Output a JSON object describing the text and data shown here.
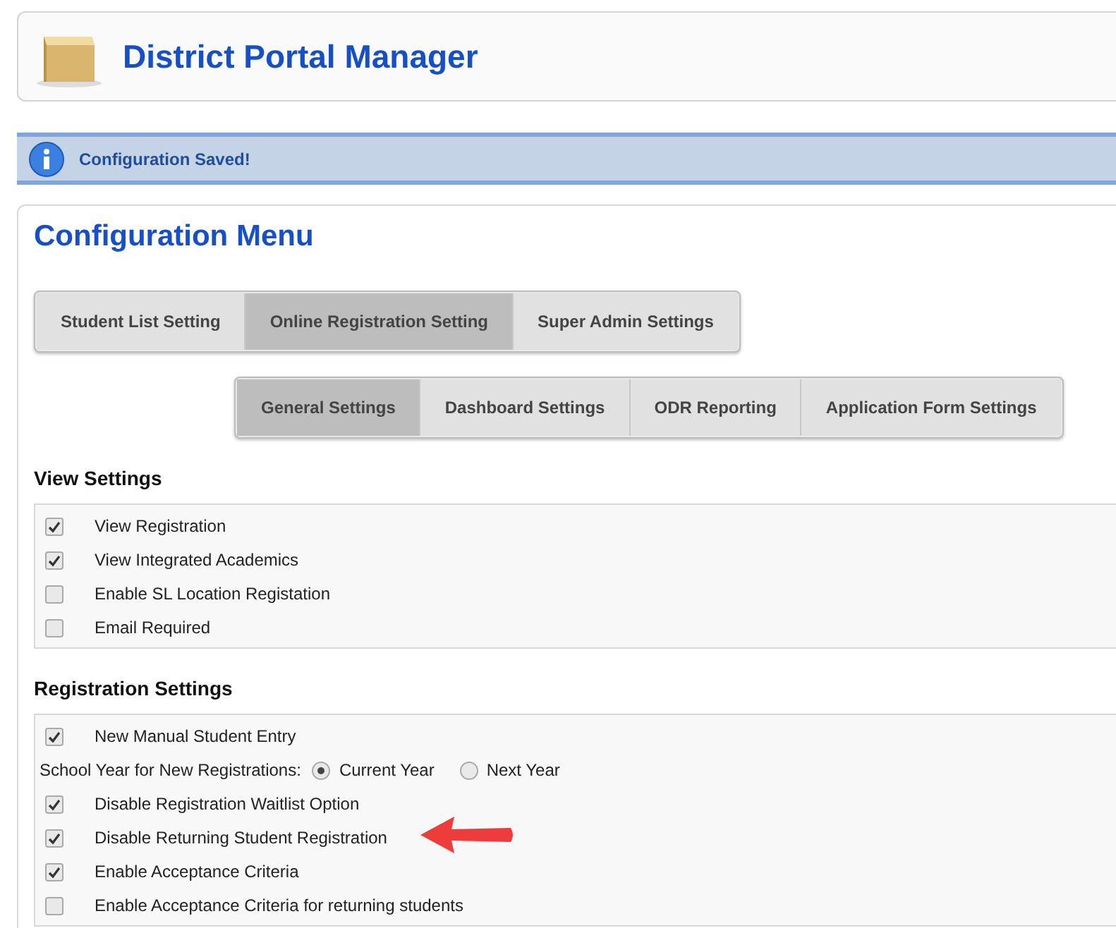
{
  "header": {
    "title": "District Portal Manager"
  },
  "notice": {
    "message": "Configuration Saved!"
  },
  "config": {
    "title": "Configuration Menu",
    "tabs": [
      {
        "label": "Student List Setting",
        "selected": false
      },
      {
        "label": "Online Registration Setting",
        "selected": true
      },
      {
        "label": "Super Admin Settings",
        "selected": false
      }
    ],
    "subtabs": [
      {
        "label": "General Settings",
        "selected": true
      },
      {
        "label": "Dashboard Settings",
        "selected": false
      },
      {
        "label": "ODR Reporting",
        "selected": false
      },
      {
        "label": "Application Form Settings",
        "selected": false
      }
    ],
    "sections": [
      {
        "title": "View Settings",
        "rows": [
          {
            "kind": "checkbox",
            "label": "View Registration",
            "checked": true
          },
          {
            "kind": "checkbox",
            "label": "View Integrated Academics",
            "checked": true
          },
          {
            "kind": "checkbox",
            "label": "Enable SL Location Registation",
            "checked": false
          },
          {
            "kind": "checkbox",
            "label": "Email Required",
            "checked": false
          }
        ]
      },
      {
        "title": "Registration Settings",
        "rows": [
          {
            "kind": "checkbox",
            "label": "New Manual Student Entry",
            "checked": true
          },
          {
            "kind": "radio",
            "label": "School Year for New Registrations:",
            "options": [
              {
                "label": "Current Year",
                "selected": true
              },
              {
                "label": "Next Year",
                "selected": false
              }
            ]
          },
          {
            "kind": "checkbox",
            "label": "Disable Registration Waitlist Option",
            "checked": true
          },
          {
            "kind": "checkbox",
            "label": "Disable Returning Student Registration",
            "checked": true,
            "pointed": true
          },
          {
            "kind": "checkbox",
            "label": "Enable Acceptance Criteria",
            "checked": true
          },
          {
            "kind": "checkbox",
            "label": "Enable Acceptance Criteria for returning students",
            "checked": false
          }
        ]
      }
    ]
  }
}
